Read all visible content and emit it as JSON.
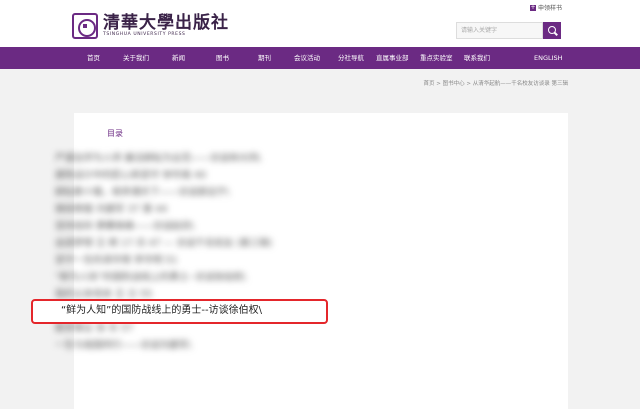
{
  "header": {
    "logo_cn": "清華大學出版社",
    "logo_en": "TSINGHUA UNIVERSITY PRESS",
    "apply_label": "申领样书",
    "search_placeholder": "请输入关键字"
  },
  "nav": {
    "items": [
      "首页",
      "关于我们",
      "新闻",
      "图书",
      "期刊",
      "会议活动",
      "分社导航",
      "直属事业部",
      "重点实验室",
      "联系我们",
      "ENGLISH"
    ]
  },
  "breadcrumb": "首页 > 图书中心 > 从清华起航——千名校友访谈录 第三辑",
  "toc": {
    "label": "目录",
    "blurred_items": [
      "严谨治学为人师 廉洁耕耘为业范——访谈林大同\\",
      "建筑设计中的匠心和坚守 钟华南 40",
      "耕耘数十载，桃李满天下——访谈郭远宁\\",
      "铸就辉煌 刘建军 37 第 44",
      "坚持信仰 勇攀高峰——访谈赵欣\\",
      "追逐梦想 王 辉 17 月 47 — 访谈千名校友 (第三辑)",
      "坚守一生的清华情 李华明 51",
      "“鲜为人知”的国防战线上的勇士--访谈徐伯权\\",
      "我的父亲母亲 王 兰 55",
      "清华人生 筑梦前行——访谈吴海鹏\\",
      "教育事业 张 东 57",
      "一生与祖国同行——访谈刘建军\\"
    ],
    "highlighted_item": "“鲜为人知”的国防战线上的勇士--访谈徐伯权\\"
  }
}
